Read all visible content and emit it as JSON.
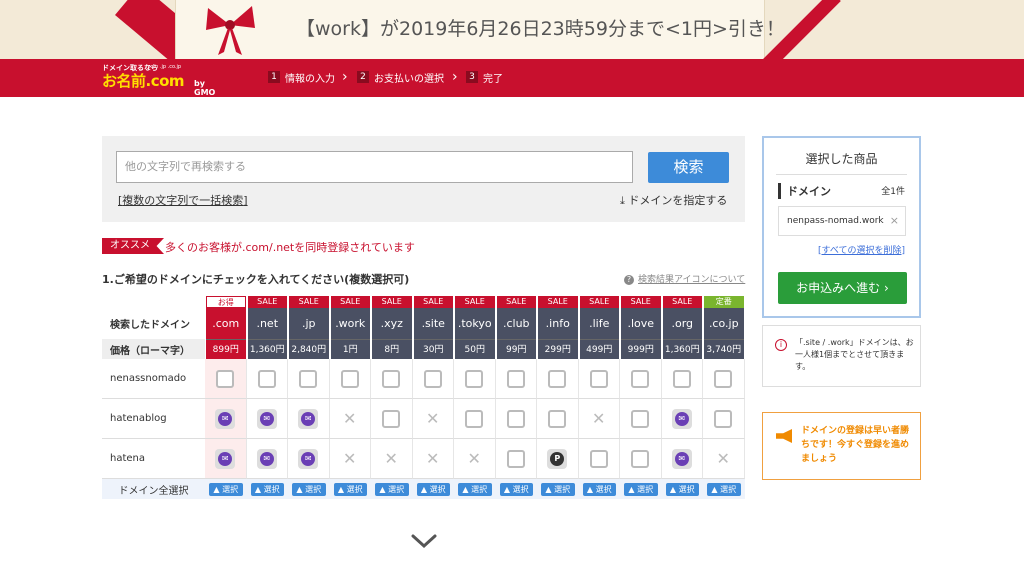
{
  "banner": {
    "text": "【work】が2019年6月26日23時59分まで<1円>引き！"
  },
  "logo": {
    "small": "ドメイン取るなら",
    "brand": "お名前.com",
    "ext": ".com .jp .co.jp",
    "gmo": "by GMO"
  },
  "steps": [
    {
      "num": "1",
      "label": "情報の入力"
    },
    {
      "num": "2",
      "label": "お支払いの選択"
    },
    {
      "num": "3",
      "label": "完了"
    }
  ],
  "search": {
    "placeholder": "他の文字列で再検索する",
    "button": "検索",
    "bulk_link": "複数の文字列で一括検索",
    "specify": "ドメインを指定する"
  },
  "recommend": {
    "tag": "オススメ",
    "text": "多くのお客様が.com/.netを同時登録されています"
  },
  "instruction": "1.ご希望のドメインにチェックを入れてください(複数選択可)",
  "icon_help": "検索結果アイコンについて",
  "grid": {
    "label_searched": "検索したドメイン",
    "label_price": "価格（ローマ字）",
    "label_select_all": "ドメイン全選択",
    "select_label": "選択",
    "tlds": [
      {
        "badge": "お得",
        "badge_color": "#ffffff",
        "tld": ".com",
        "price": "899円",
        "highlight": true
      },
      {
        "badge": "SALE",
        "badge_color": "#c8102e",
        "tld": ".net",
        "price": "1,360円"
      },
      {
        "badge": "SALE",
        "badge_color": "#c8102e",
        "tld": ".jp",
        "price": "2,840円"
      },
      {
        "badge": "SALE",
        "badge_color": "#c8102e",
        "tld": ".work",
        "price": "1円"
      },
      {
        "badge": "SALE",
        "badge_color": "#c8102e",
        "tld": ".xyz",
        "price": "8円"
      },
      {
        "badge": "SALE",
        "badge_color": "#c8102e",
        "tld": ".site",
        "price": "30円"
      },
      {
        "badge": "SALE",
        "badge_color": "#c8102e",
        "tld": ".tokyo",
        "price": "50円"
      },
      {
        "badge": "SALE",
        "badge_color": "#c8102e",
        "tld": ".club",
        "price": "99円"
      },
      {
        "badge": "SALE",
        "badge_color": "#c8102e",
        "tld": ".info",
        "price": "299円"
      },
      {
        "badge": "SALE",
        "badge_color": "#c8102e",
        "tld": ".life",
        "price": "499円"
      },
      {
        "badge": "SALE",
        "badge_color": "#c8102e",
        "tld": ".love",
        "price": "999円"
      },
      {
        "badge": "SALE",
        "badge_color": "#c8102e",
        "tld": ".org",
        "price": "1,360円"
      },
      {
        "badge": "定番",
        "badge_color": "#7ab52e",
        "tld": ".co.jp",
        "price": "3,740円"
      }
    ],
    "rows": [
      {
        "name": "nenassnomado",
        "cells": [
          "cb",
          "cb",
          "cb",
          "cb",
          "cb",
          "cb",
          "cb",
          "cb",
          "cb",
          "cb",
          "cb",
          "cb",
          "cb"
        ]
      },
      {
        "name": "hatenablog",
        "cells": [
          "mail",
          "mail",
          "mail",
          "x",
          "cb",
          "x",
          "cb",
          "cb",
          "cb",
          "x",
          "cb",
          "mail",
          "cb"
        ]
      },
      {
        "name": "hatena",
        "cells": [
          "mail",
          "mail",
          "mail",
          "x",
          "x",
          "x",
          "x",
          "cb",
          "pk",
          "cb",
          "cb",
          "mail",
          "x"
        ]
      }
    ]
  },
  "cart": {
    "title": "選択した商品",
    "domain_label": "ドメイン",
    "count": "全1件",
    "item": "nenpass-nomad.work",
    "remove_symbol": "×",
    "clear_all_prefix": "[",
    "clear_all": "すべての選択を削除",
    "clear_all_suffix": "]",
    "apply": "お申込みへ進む"
  },
  "notice": {
    "text": "「.site / .work」ドメインは、お一人様1個までとさせて頂きます。"
  },
  "promo": {
    "text": "ドメインの登録は早い者勝ちです！今すぐ登録を進めましょう"
  }
}
